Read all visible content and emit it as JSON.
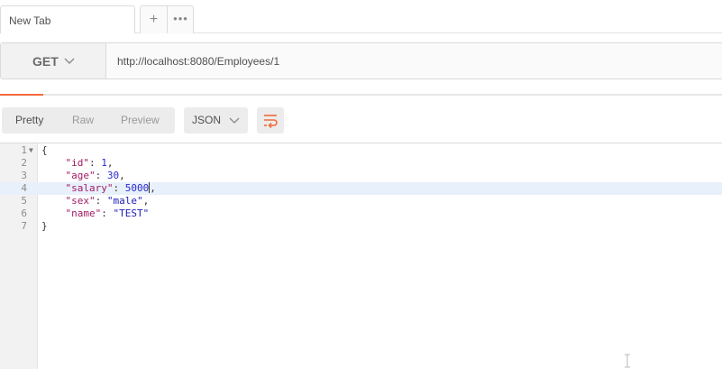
{
  "tabs": {
    "active_tab_label": "New Tab",
    "add_tab_label": "+",
    "more_label": "•••"
  },
  "request": {
    "method": "GET",
    "url": "http://localhost:8080/Employees/1"
  },
  "response": {
    "progress": 0.06,
    "view_modes": [
      "Pretty",
      "Raw",
      "Preview"
    ],
    "active_view": "Pretty",
    "format": "JSON",
    "lines": [
      {
        "num": "1",
        "text": "{"
      },
      {
        "num": "2",
        "key": "\"id\"",
        "value": "1",
        "trail": ","
      },
      {
        "num": "3",
        "key": "\"age\"",
        "value": "30",
        "trail": ","
      },
      {
        "num": "4",
        "key": "\"salary\"",
        "value": "5000",
        "trail": ","
      },
      {
        "num": "5",
        "key": "\"sex\"",
        "value": "\"male\"",
        "trail": ","
      },
      {
        "num": "6",
        "key": "\"name\"",
        "value": "\"TEST\"",
        "trail": ""
      },
      {
        "num": "7",
        "text": "}"
      }
    ],
    "active_line": 4
  },
  "colors": {
    "accent": "#f26b3a",
    "json_key": "#a11b66",
    "json_string": "#1c1cb8",
    "json_number": "#2a2acf"
  }
}
